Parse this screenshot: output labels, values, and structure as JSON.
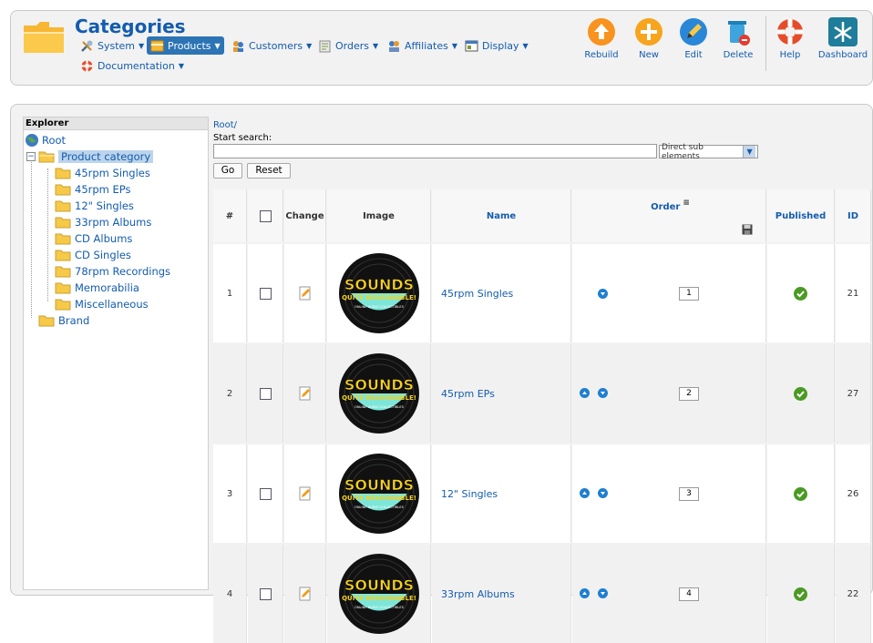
{
  "header": {
    "title": "Categories",
    "menu": [
      {
        "label": "System",
        "icon": "tools-icon",
        "active": false
      },
      {
        "label": "Products",
        "icon": "products-icon",
        "active": true
      },
      {
        "label": "Customers",
        "icon": "customers-icon",
        "active": false
      },
      {
        "label": "Orders",
        "icon": "orders-icon",
        "active": false
      },
      {
        "label": "Affiliates",
        "icon": "affiliates-icon",
        "active": false
      },
      {
        "label": "Display",
        "icon": "display-icon",
        "active": false
      },
      {
        "label": "Documentation",
        "icon": "lifebuoy-icon",
        "active": false
      }
    ],
    "toolbar": [
      {
        "label": "Rebuild",
        "icon": "rebuild-icon"
      },
      {
        "label": "New",
        "icon": "new-icon"
      },
      {
        "label": "Edit",
        "icon": "edit-icon"
      },
      {
        "label": "Delete",
        "icon": "delete-icon"
      },
      {
        "label": "Help",
        "icon": "help-icon"
      },
      {
        "label": "Dashboard",
        "icon": "dashboard-icon"
      }
    ]
  },
  "explorer": {
    "title": "Explorer",
    "root": "Root",
    "selected": "Product category",
    "children": [
      "45rpm Singles",
      "45rpm EPs",
      "12\" Singles",
      "33rpm Albums",
      "CD Albums",
      "CD Singles",
      "78rpm Recordings",
      "Memorabilia",
      "Miscellaneous"
    ],
    "sibling": "Brand"
  },
  "content": {
    "breadcrumb": "Root/",
    "search_label": "Start search:",
    "search_value": "",
    "scope_select": "Direct sub elements",
    "go_label": "Go",
    "reset_label": "Reset",
    "columns": {
      "number": "#",
      "change": "Change",
      "image": "Image",
      "name": "Name",
      "order": "Order",
      "published": "Published",
      "id": "ID"
    },
    "image_logo": {
      "line1": "SOUNDS",
      "line2": "QUITE REASONABLE!",
      "line3": "ONLINE AUDIO COLLECTIBLES"
    },
    "rows": [
      {
        "num": "1",
        "name": "45rpm Singles",
        "order": "1",
        "id": "21",
        "up": false,
        "down": true
      },
      {
        "num": "2",
        "name": "45rpm EPs",
        "order": "2",
        "id": "27",
        "up": true,
        "down": true
      },
      {
        "num": "3",
        "name": "12\" Singles",
        "order": "3",
        "id": "26",
        "up": true,
        "down": true
      },
      {
        "num": "4",
        "name": "33rpm Albums",
        "order": "4",
        "id": "22",
        "up": true,
        "down": true
      }
    ]
  },
  "colors": {
    "accent": "#135cae",
    "active_menu": "#2d74b5",
    "published": "#4a9a24"
  }
}
